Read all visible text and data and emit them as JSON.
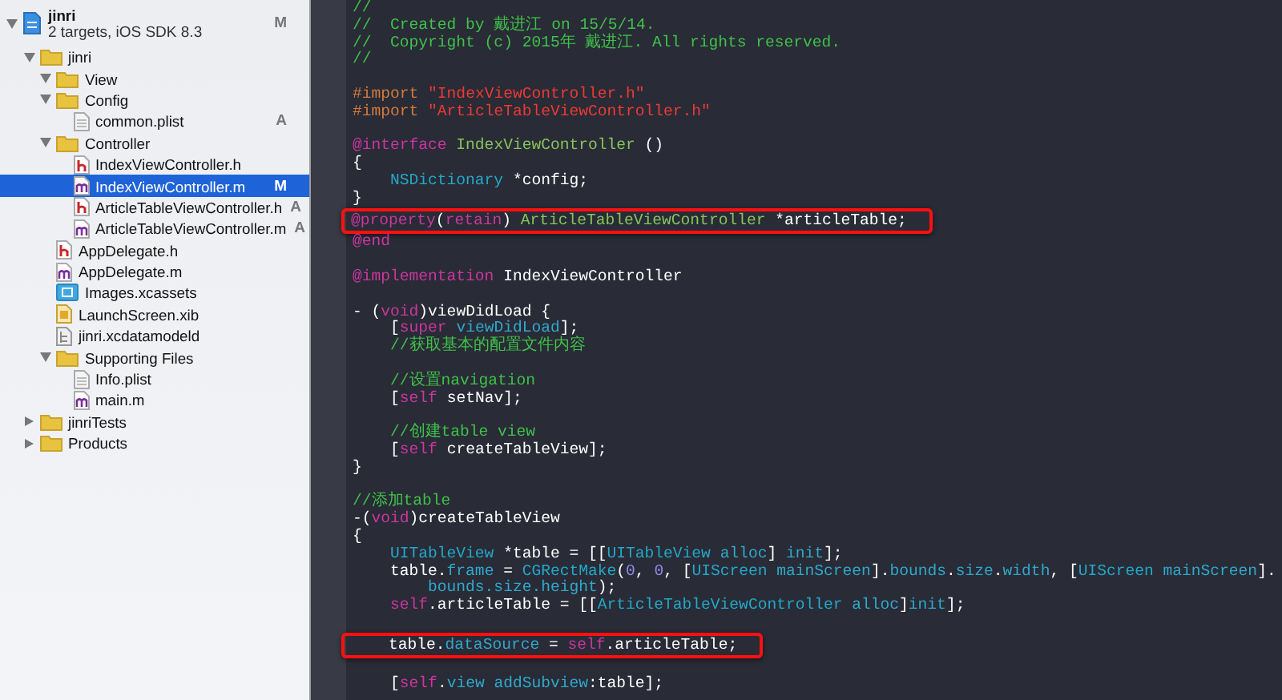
{
  "navigator": {
    "items": [
      {
        "name": "jinri",
        "subtitle": "2 targets, iOS SDK 8.3",
        "kind": "project",
        "badge": "M",
        "expanded": true,
        "selected": false,
        "children": [
          {
            "name": "jinri",
            "kind": "folder",
            "expanded": true,
            "selected": false,
            "children": [
              {
                "name": "View",
                "kind": "folder",
                "expanded": true,
                "selected": false
              },
              {
                "name": "Config",
                "kind": "folder",
                "expanded": true,
                "selected": false,
                "children": [
                  {
                    "name": "common.plist",
                    "kind": "plist",
                    "badge": "A",
                    "selected": false
                  }
                ]
              },
              {
                "name": "Controller",
                "kind": "folder",
                "expanded": true,
                "selected": false,
                "children": [
                  {
                    "name": "IndexViewController.h",
                    "kind": "header",
                    "selected": false
                  },
                  {
                    "name": "IndexViewController.m",
                    "kind": "source",
                    "badge": "M",
                    "selected": true
                  },
                  {
                    "name": "ArticleTableViewController.h",
                    "kind": "header",
                    "badge": "A",
                    "selected": false
                  },
                  {
                    "name": "ArticleTableViewController.m",
                    "kind": "source",
                    "badge": "A",
                    "selected": false
                  }
                ]
              },
              {
                "name": "AppDelegate.h",
                "kind": "header",
                "selected": false
              },
              {
                "name": "AppDelegate.m",
                "kind": "source",
                "selected": false
              },
              {
                "name": "Images.xcassets",
                "kind": "assets",
                "selected": false
              },
              {
                "name": "LaunchScreen.xib",
                "kind": "xib",
                "selected": false
              },
              {
                "name": "jinri.xcdatamodeld",
                "kind": "datamodel",
                "selected": false
              },
              {
                "name": "Supporting Files",
                "kind": "folder",
                "expanded": true,
                "selected": false,
                "children": [
                  {
                    "name": "Info.plist",
                    "kind": "plist",
                    "selected": false
                  },
                  {
                    "name": "main.m",
                    "kind": "source",
                    "selected": false
                  }
                ]
              }
            ]
          },
          {
            "name": "jinriTests",
            "kind": "folder",
            "expanded": false,
            "selected": false
          },
          {
            "name": "Products",
            "kind": "folder",
            "expanded": false,
            "selected": false
          }
        ]
      }
    ]
  },
  "editor": {
    "lines": [
      {
        "kind": "code",
        "highlighted": false,
        "tokens": [
          {
            "kind": "comment",
            "text": "//"
          }
        ]
      },
      {
        "kind": "code",
        "highlighted": false,
        "tokens": [
          {
            "kind": "comment",
            "text": "//  Created by 戴进江 on 15/5/14."
          }
        ]
      },
      {
        "kind": "code",
        "highlighted": false,
        "tokens": [
          {
            "kind": "comment",
            "text": "//  Copyright (c) 2015年 戴进江. All rights reserved."
          }
        ]
      },
      {
        "kind": "code",
        "highlighted": false,
        "tokens": [
          {
            "kind": "comment",
            "text": "//"
          }
        ]
      },
      {
        "kind": "blank",
        "highlighted": false
      },
      {
        "kind": "code",
        "highlighted": false,
        "tokens": [
          {
            "kind": "preproc",
            "text": "#import "
          },
          {
            "kind": "string",
            "text": "\"IndexViewController.h\""
          }
        ]
      },
      {
        "kind": "code",
        "highlighted": false,
        "tokens": [
          {
            "kind": "preproc",
            "text": "#import "
          },
          {
            "kind": "string",
            "text": "\"ArticleTableViewController.h\""
          }
        ]
      },
      {
        "kind": "blank",
        "highlighted": false
      },
      {
        "kind": "code",
        "highlighted": false,
        "tokens": [
          {
            "kind": "keyword",
            "text": "@interface "
          },
          {
            "kind": "project",
            "text": "IndexViewController"
          },
          {
            "kind": "plain",
            "text": " ()"
          }
        ]
      },
      {
        "kind": "code",
        "highlighted": false,
        "tokens": [
          {
            "kind": "plain",
            "text": "{"
          }
        ]
      },
      {
        "kind": "code",
        "highlighted": false,
        "tokens": [
          {
            "kind": "type",
            "text": "    NSDictionary"
          },
          {
            "kind": "plain",
            "text": " *config;"
          }
        ]
      },
      {
        "kind": "code",
        "highlighted": false,
        "tokens": [
          {
            "kind": "plain",
            "text": "}"
          }
        ]
      },
      {
        "kind": "code",
        "highlighted": true,
        "tokens": [
          {
            "kind": "keyword",
            "text": "@property"
          },
          {
            "kind": "plain",
            "text": "("
          },
          {
            "kind": "keyword",
            "text": "retain"
          },
          {
            "kind": "plain",
            "text": ") "
          },
          {
            "kind": "project",
            "text": "ArticleTableViewController"
          },
          {
            "kind": "plain",
            "text": " *articleTable;"
          }
        ]
      },
      {
        "kind": "code",
        "highlighted": false,
        "tokens": [
          {
            "kind": "keyword",
            "text": "@end"
          }
        ]
      },
      {
        "kind": "blank",
        "highlighted": false
      },
      {
        "kind": "code",
        "highlighted": false,
        "tokens": [
          {
            "kind": "keyword",
            "text": "@implementation"
          },
          {
            "kind": "plain",
            "text": " IndexViewController"
          }
        ]
      },
      {
        "kind": "blank",
        "highlighted": false
      },
      {
        "kind": "code",
        "highlighted": false,
        "tokens": [
          {
            "kind": "plain",
            "text": "- ("
          },
          {
            "kind": "keyword",
            "text": "void"
          },
          {
            "kind": "plain",
            "text": ")viewDidLoad {"
          }
        ]
      },
      {
        "kind": "code",
        "highlighted": false,
        "tokens": [
          {
            "kind": "plain",
            "text": "    ["
          },
          {
            "kind": "keyword",
            "text": "super "
          },
          {
            "kind": "method",
            "text": "viewDidLoad"
          },
          {
            "kind": "plain",
            "text": "];"
          }
        ]
      },
      {
        "kind": "code",
        "highlighted": false,
        "tokens": [
          {
            "kind": "comment",
            "text": "    //获取基本的配置文件内容"
          }
        ]
      },
      {
        "kind": "blank",
        "highlighted": false
      },
      {
        "kind": "code",
        "highlighted": false,
        "tokens": [
          {
            "kind": "comment",
            "text": "    //设置navigation"
          }
        ]
      },
      {
        "kind": "code",
        "highlighted": false,
        "tokens": [
          {
            "kind": "plain",
            "text": "    ["
          },
          {
            "kind": "keyword",
            "text": "self"
          },
          {
            "kind": "plain",
            "text": " setNav];"
          }
        ]
      },
      {
        "kind": "blank",
        "highlighted": false
      },
      {
        "kind": "code",
        "highlighted": false,
        "tokens": [
          {
            "kind": "comment",
            "text": "    //创建table view"
          }
        ]
      },
      {
        "kind": "code",
        "highlighted": false,
        "tokens": [
          {
            "kind": "plain",
            "text": "    ["
          },
          {
            "kind": "keyword",
            "text": "self"
          },
          {
            "kind": "plain",
            "text": " createTableView];"
          }
        ]
      },
      {
        "kind": "code",
        "highlighted": false,
        "tokens": [
          {
            "kind": "plain",
            "text": "}"
          }
        ]
      },
      {
        "kind": "blank",
        "highlighted": false
      },
      {
        "kind": "code",
        "highlighted": false,
        "tokens": [
          {
            "kind": "comment",
            "text": "//添加table"
          }
        ]
      },
      {
        "kind": "code",
        "highlighted": false,
        "tokens": [
          {
            "kind": "plain",
            "text": "-("
          },
          {
            "kind": "keyword",
            "text": "void"
          },
          {
            "kind": "plain",
            "text": ")createTableView"
          }
        ]
      },
      {
        "kind": "code",
        "highlighted": false,
        "tokens": [
          {
            "kind": "plain",
            "text": "{"
          }
        ]
      },
      {
        "kind": "code",
        "highlighted": false,
        "tokens": [
          {
            "kind": "type",
            "text": "    UITableView"
          },
          {
            "kind": "plain",
            "text": " *table = [["
          },
          {
            "kind": "type",
            "text": "UITableView "
          },
          {
            "kind": "method",
            "text": "alloc"
          },
          {
            "kind": "plain",
            "text": "] "
          },
          {
            "kind": "method",
            "text": "init"
          },
          {
            "kind": "plain",
            "text": "];"
          }
        ]
      },
      {
        "kind": "code",
        "highlighted": false,
        "tokens": [
          {
            "kind": "plain",
            "text": "    table."
          },
          {
            "kind": "method",
            "text": "frame"
          },
          {
            "kind": "plain",
            "text": " = "
          },
          {
            "kind": "type",
            "text": "CGRectMake"
          },
          {
            "kind": "plain",
            "text": "("
          },
          {
            "kind": "number",
            "text": "0"
          },
          {
            "kind": "plain",
            "text": ", "
          },
          {
            "kind": "number",
            "text": "0"
          },
          {
            "kind": "plain",
            "text": ", ["
          },
          {
            "kind": "type",
            "text": "UIScreen "
          },
          {
            "kind": "method",
            "text": "mainScreen"
          },
          {
            "kind": "plain",
            "text": "]."
          },
          {
            "kind": "method",
            "text": "bounds"
          },
          {
            "kind": "plain",
            "text": "."
          },
          {
            "kind": "method",
            "text": "size"
          },
          {
            "kind": "plain",
            "text": "."
          },
          {
            "kind": "method",
            "text": "width"
          },
          {
            "kind": "plain",
            "text": ", ["
          },
          {
            "kind": "type",
            "text": "UIScreen "
          },
          {
            "kind": "method",
            "text": "mainScreen"
          },
          {
            "kind": "plain",
            "text": "]."
          }
        ]
      },
      {
        "kind": "code",
        "highlighted": false,
        "tokens": [
          {
            "kind": "method",
            "text": "        bounds.size.height"
          },
          {
            "kind": "plain",
            "text": ");"
          }
        ]
      },
      {
        "kind": "code",
        "highlighted": false,
        "tokens": [
          {
            "kind": "keyword",
            "text": "    self"
          },
          {
            "kind": "plain",
            "text": ".articleTable = [["
          },
          {
            "kind": "type",
            "text": "ArticleTableViewController "
          },
          {
            "kind": "method",
            "text": "alloc"
          },
          {
            "kind": "plain",
            "text": "]"
          },
          {
            "kind": "method",
            "text": "init"
          },
          {
            "kind": "plain",
            "text": "];"
          }
        ]
      },
      {
        "kind": "blank",
        "highlighted": false
      },
      {
        "kind": "code",
        "highlighted": true,
        "tokens": [
          {
            "kind": "plain",
            "text": "    table."
          },
          {
            "kind": "method",
            "text": "dataSource"
          },
          {
            "kind": "plain",
            "text": " = "
          },
          {
            "kind": "keyword",
            "text": "self"
          },
          {
            "kind": "plain",
            "text": ".articleTable;"
          }
        ]
      },
      {
        "kind": "blank",
        "highlighted": false
      },
      {
        "kind": "code",
        "highlighted": false,
        "tokens": [
          {
            "kind": "plain",
            "text": "    ["
          },
          {
            "kind": "keyword",
            "text": "self"
          },
          {
            "kind": "plain",
            "text": "."
          },
          {
            "kind": "method",
            "text": "view addSubview"
          },
          {
            "kind": "plain",
            "text": ":table];"
          }
        ]
      }
    ]
  }
}
